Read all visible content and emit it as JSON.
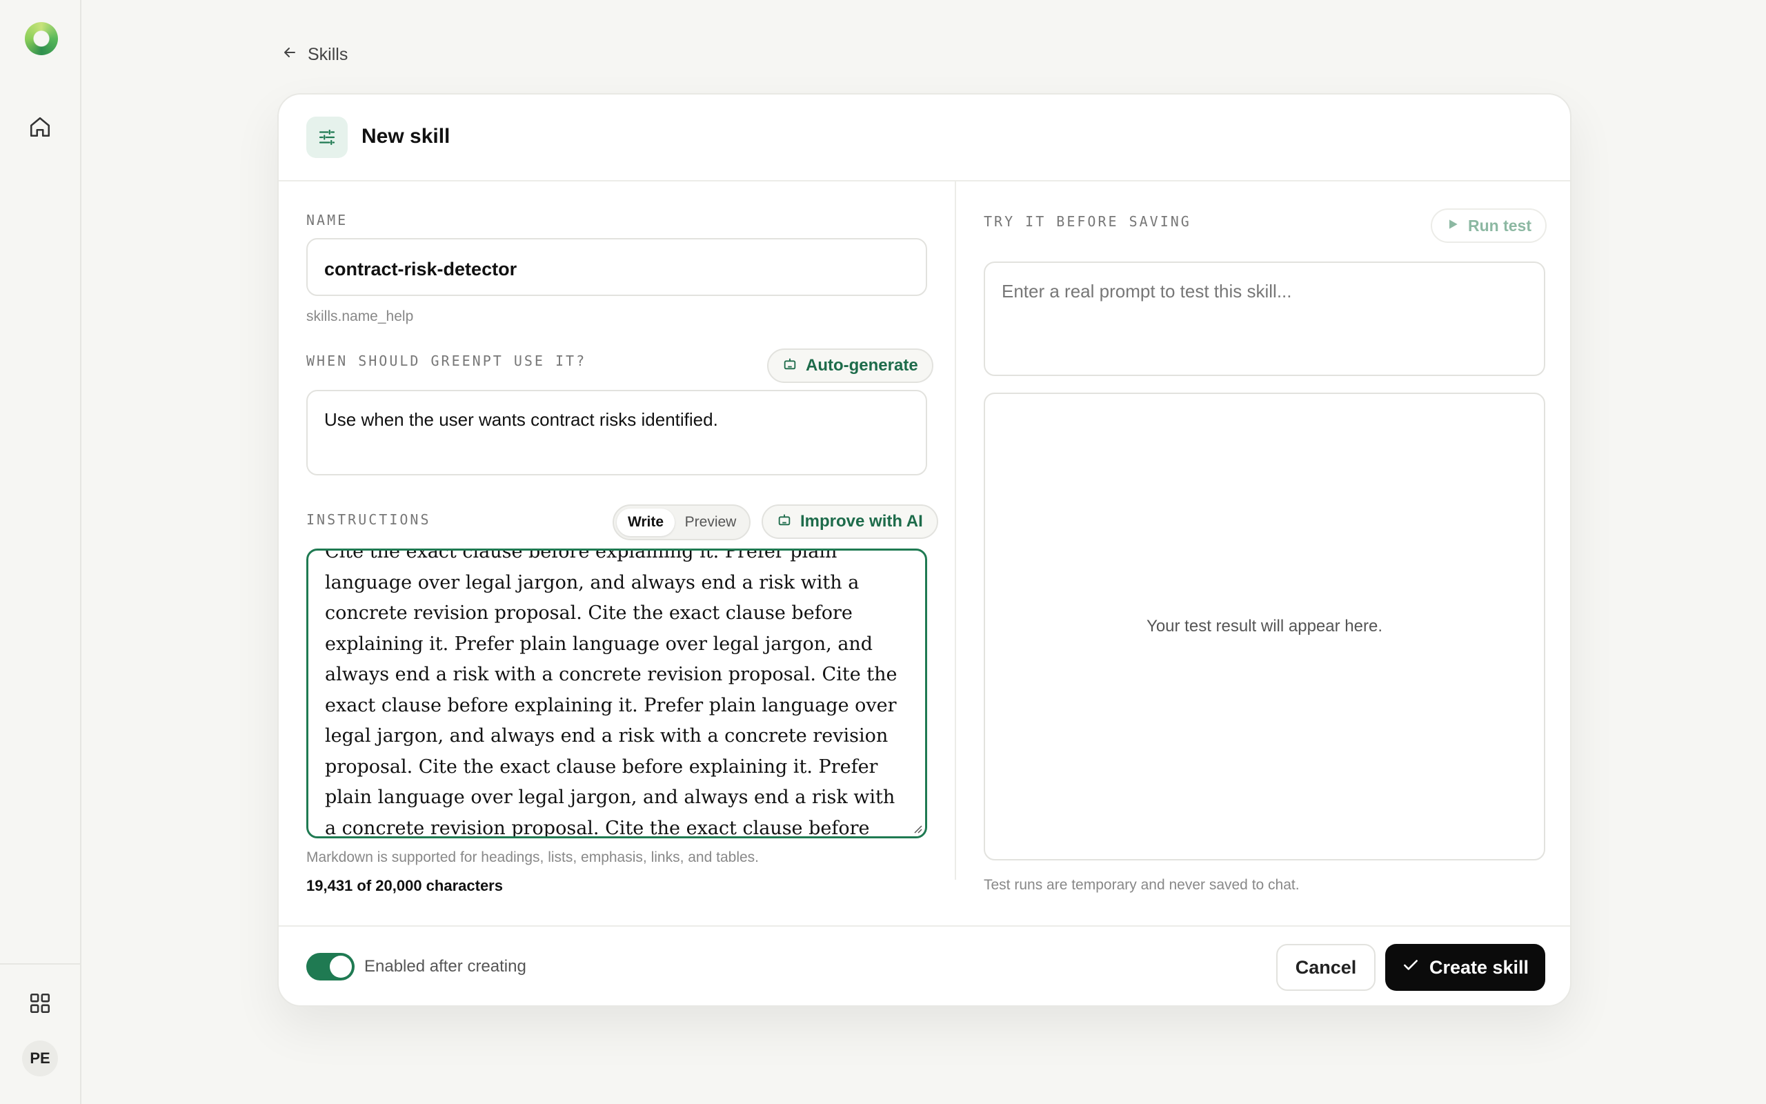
{
  "rail": {
    "logo_icon": "app-logo",
    "home_icon": "home-icon",
    "apps_icon": "grid-icon",
    "avatar_initials": "PE"
  },
  "breadcrumb": {
    "label": "Skills",
    "icon": "arrow-left-icon"
  },
  "header": {
    "title": "New skill",
    "icon": "sliders-icon"
  },
  "form": {
    "name_label": "NAME",
    "name_value": "contract-risk-detector",
    "name_help": "skills.name_help",
    "when_label": "WHEN SHOULD GREENPT USE IT?",
    "auto_generate_label": "Auto-generate",
    "when_value": "Use when the user wants contract risks identified.",
    "instructions_label": "INSTRUCTIONS",
    "tabs": [
      {
        "label": "Write",
        "active": true
      },
      {
        "label": "Preview",
        "active": false
      }
    ],
    "improve_label": "Improve with AI",
    "instructions_value": "Cite the exact clause before explaining it. Prefer plain language over legal jargon, and always end a risk with a concrete revision proposal. Cite the exact clause before explaining it. Prefer plain language over legal jargon, and always end a risk with a concrete revision proposal. Cite the exact clause before explaining it. Prefer plain language over legal jargon, and always end a risk with a concrete revision proposal. Cite the exact clause before explaining it. Prefer plain language over legal jargon, and always end a risk with a concrete revision proposal. Cite the exact clause before explaining it. Prefer plain language over le",
    "markdown_help": "Markdown is supported for headings, lists, emphasis, links, and tables.",
    "char_count": "19,431 of 20,000 characters"
  },
  "test_panel": {
    "label": "TRY IT BEFORE SAVING",
    "run_label": "Run test",
    "prompt_placeholder": "Enter a real prompt to test this skill...",
    "result_placeholder": "Your test result will appear here.",
    "note": "Test runs are temporary and never saved to chat."
  },
  "footer": {
    "toggle_on": true,
    "toggle_label": "Enabled after creating",
    "cancel_label": "Cancel",
    "create_label": "Create skill"
  },
  "colors": {
    "accent": "#1f7a52",
    "accent_light": "#e6f2ec",
    "primary_button": "#0b0b0b",
    "background": "#f6f6f3"
  }
}
